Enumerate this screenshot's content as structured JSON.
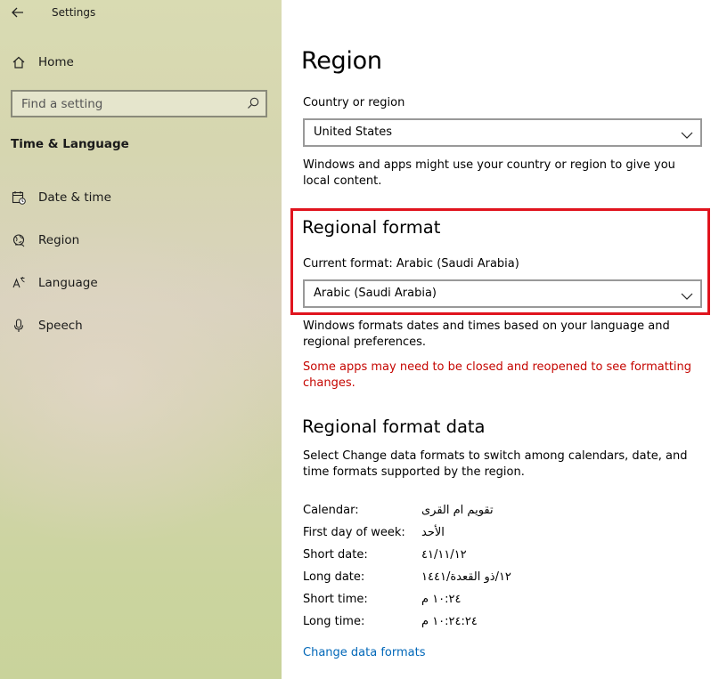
{
  "app": {
    "title": "Settings"
  },
  "sidebar": {
    "home_label": "Home",
    "search_placeholder": "Find a setting",
    "section_title": "Time & Language",
    "items": [
      {
        "label": "Date & time",
        "icon": "calendar-clock-icon"
      },
      {
        "label": "Region",
        "icon": "globe-icon"
      },
      {
        "label": "Language",
        "icon": "language-icon"
      },
      {
        "label": "Speech",
        "icon": "microphone-icon"
      }
    ]
  },
  "main": {
    "title": "Region",
    "country": {
      "label": "Country or region",
      "selected": "United States",
      "description": "Windows and apps might use your country or region to give you local content."
    },
    "regional_format": {
      "heading": "Regional format",
      "current_label": "Current format: Arabic (Saudi Arabia)",
      "selected": "Arabic (Saudi Arabia)",
      "description": "Windows formats dates and times based on your language and regional preferences.",
      "warning": "Some apps may need to be closed and reopened to see formatting changes."
    },
    "format_data": {
      "heading": "Regional format data",
      "description": "Select Change data formats to switch among calendars, date, and time formats supported by the region.",
      "rows": [
        {
          "key": "Calendar:",
          "value": "تقويم ام القرى"
        },
        {
          "key": "First day of week:",
          "value": "الأحد"
        },
        {
          "key": "Short date:",
          "value": "٤١/١١/١٢"
        },
        {
          "key": "Long date:",
          "value": "١٢/ذو القعدة/١٤٤١"
        },
        {
          "key": "Short time:",
          "value": "١٠:٢٤ م"
        },
        {
          "key": "Long time:",
          "value": "١٠:٢٤:٢٤ م"
        }
      ],
      "link": "Change data formats"
    }
  },
  "colors": {
    "highlight": "#e0141e",
    "warning": "#c50500",
    "link": "#0067b8"
  }
}
